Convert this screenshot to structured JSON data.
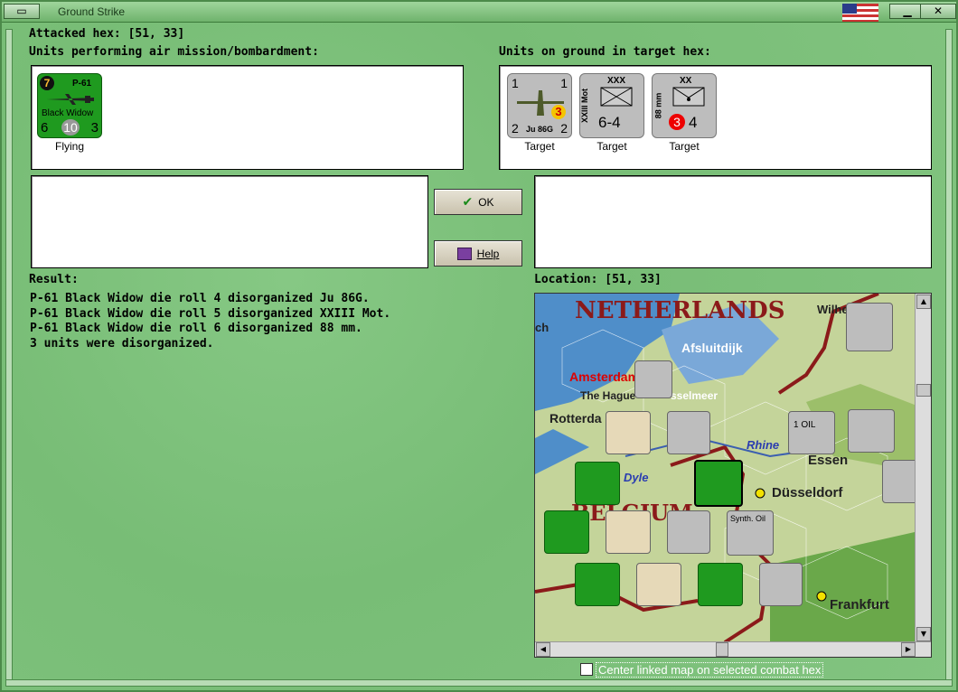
{
  "window": {
    "title": "Ground Strike"
  },
  "header": {
    "attacked_hex": "Attacked hex:  [51, 33]"
  },
  "air_units": {
    "label": "Units performing air mission/bombardment:",
    "units": [
      {
        "badge": "7",
        "name": "P-61",
        "subname": "Black Widow",
        "left": "6",
        "center": "10",
        "right": "3",
        "caption": "Flying",
        "color": "#1f9a1f"
      }
    ]
  },
  "ground_units": {
    "label": "Units on ground in target hex:",
    "units": [
      {
        "top_left": "1",
        "top_right": "1",
        "name": "Ju 86G",
        "bottom_left": "2",
        "bottom_right": "2",
        "marker": "3",
        "caption": "Target"
      },
      {
        "size": "XXX",
        "side": "XXIII Mot",
        "values": "6-4",
        "caption": "Target"
      },
      {
        "size": "XX",
        "side": "88 mm",
        "circle": "3",
        "right": "4",
        "caption": "Target"
      }
    ]
  },
  "buttons": {
    "ok": "OK",
    "help": "Help"
  },
  "result": {
    "label": "Result:",
    "lines": [
      "P-61 Black Widow die roll 4 disorganized Ju 86G.",
      "P-61 Black Widow die roll 5 disorganized XXIII Mot.",
      "P-61 Black Widow die roll 6 disorganized 88 mm.",
      "3 units were disorganized."
    ]
  },
  "location": {
    "label": "Location:  [51, 33]",
    "map_labels": {
      "country1": "NETHERLANDS",
      "country2": "BELGIUM",
      "amsterdam": "Amsterdam",
      "hague": "The Hague",
      "ijsselmeer": "sselmeer",
      "rotterdam": "Rotterda",
      "afsluitdijk": "Afsluitdijk",
      "essen": "Essen",
      "rhine": "Rhine",
      "dyle": "Dyle",
      "dusseldorf": "Düsseldorf",
      "frankfurt": "Frankfurt",
      "wilhelm": "Wilhe",
      "ch": "ch",
      "oil": "1 OIL",
      "synth": "Synth. Oil"
    }
  },
  "checkbox": {
    "label": "Center linked map on selected combat hex",
    "checked": false
  },
  "colors": {
    "background": "#7cc17a",
    "allied_unit": "#1f9a1f",
    "axis_unit": "#b9b9b9",
    "map_hex_line": "#8b1a1a"
  }
}
